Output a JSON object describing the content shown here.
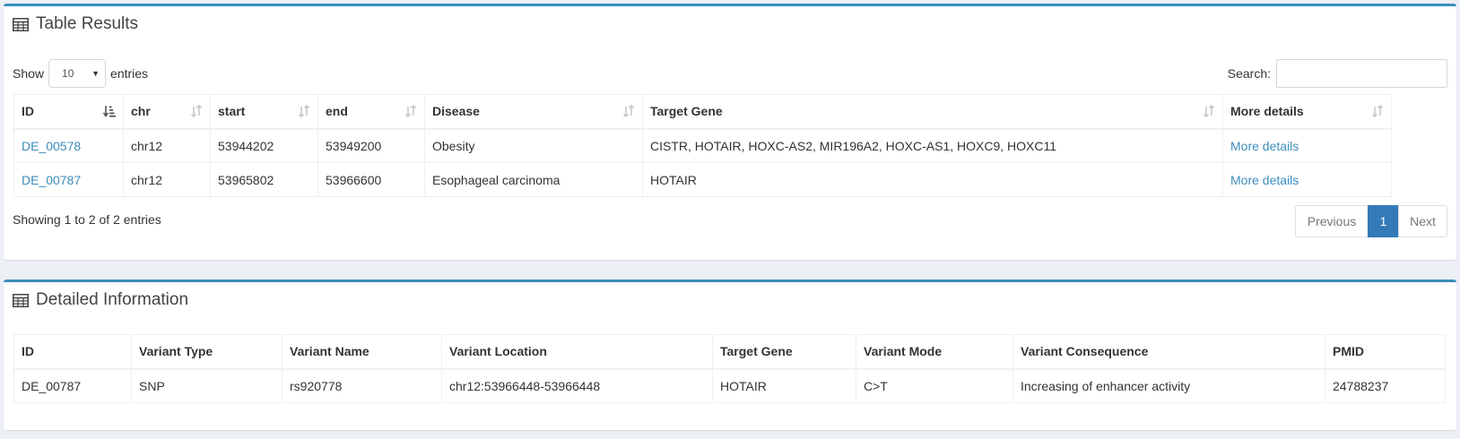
{
  "results": {
    "title": "Table Results",
    "length": {
      "show_label": "Show",
      "selected": "10",
      "entries_label": "entries"
    },
    "search": {
      "label": "Search:",
      "value": ""
    },
    "columns": [
      "ID",
      "chr",
      "start",
      "end",
      "Disease",
      "Target Gene",
      "More details"
    ],
    "rows": [
      [
        "DE_00578",
        "chr12",
        "53944202",
        "53949200",
        "Obesity",
        "CISTR, HOTAIR, HOXC-AS2, MIR196A2, HOXC-AS1, HOXC9, HOXC11",
        "More details"
      ],
      [
        "DE_00787",
        "chr12",
        "53965802",
        "53966600",
        "Esophageal carcinoma",
        "HOTAIR",
        "More details"
      ]
    ],
    "info": "Showing 1 to 2 of 2 entries",
    "pagination": {
      "previous": "Previous",
      "current": "1",
      "next": "Next"
    }
  },
  "details": {
    "title": "Detailed Information",
    "columns": [
      "ID",
      "Variant Type",
      "Variant Name",
      "Variant Location",
      "Target Gene",
      "Variant Mode",
      "Variant Consequence",
      "PMID"
    ],
    "rows": [
      [
        "DE_00787",
        "SNP",
        "rs920778",
        "chr12:53966448-53966448",
        "HOTAIR",
        "C>T",
        "Increasing of enhancer activity",
        "24788237"
      ]
    ]
  },
  "icons": {
    "table": "table-icon",
    "sort": "sort-icon",
    "sort_asc": "sort-asc-icon"
  },
  "colors": {
    "accent": "#3c8dbc",
    "pagination_active": "#337ab7",
    "link": "#3c8dbc"
  }
}
